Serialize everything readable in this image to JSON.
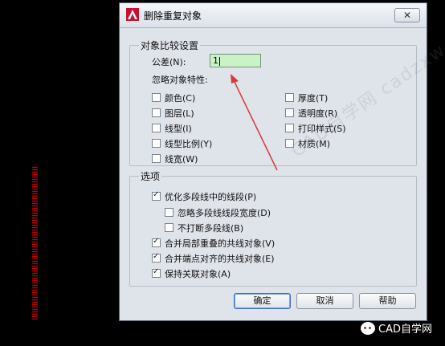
{
  "window": {
    "title": "删除重复对象",
    "close_glyph": "✕"
  },
  "compare_group": {
    "title": "对象比较设置",
    "tolerance_label": "公差(N):",
    "tolerance_value": "1",
    "ignore_label": "忽略对象特性:",
    "ignore_left": [
      {
        "label": "颜色(C)",
        "checked": false
      },
      {
        "label": "图层(L)",
        "checked": false
      },
      {
        "label": "线型(I)",
        "checked": false
      },
      {
        "label": "线型比例(Y)",
        "checked": false
      },
      {
        "label": "线宽(W)",
        "checked": false
      }
    ],
    "ignore_right": [
      {
        "label": "厚度(T)",
        "checked": false
      },
      {
        "label": "透明度(R)",
        "checked": false
      },
      {
        "label": "打印样式(S)",
        "checked": false
      },
      {
        "label": "材质(M)",
        "checked": false
      }
    ]
  },
  "options_group": {
    "title": "选项",
    "items": [
      {
        "label": "优化多段线中的线段(P)",
        "checked": true
      },
      {
        "label": "忽略多段线线段宽度(D)",
        "checked": false
      },
      {
        "label": "不打断多段线(B)",
        "checked": false
      },
      {
        "label": "合并局部重叠的共线对象(V)",
        "checked": true
      },
      {
        "label": "合并端点对齐的共线对象(E)",
        "checked": true
      },
      {
        "label": "保持关联对象(A)",
        "checked": true
      }
    ]
  },
  "buttons": {
    "ok": "确定",
    "cancel": "取消",
    "help": "帮助"
  },
  "watermark": "CAD自学网 cadzxw.com",
  "brand": "CAD自学网",
  "colors": {
    "dialog_bg": "#dfe3ea",
    "tolerance_bg": "#c9f2c9",
    "annotation_arrow": "#d63a3a",
    "app_icon": "#c8102e"
  }
}
